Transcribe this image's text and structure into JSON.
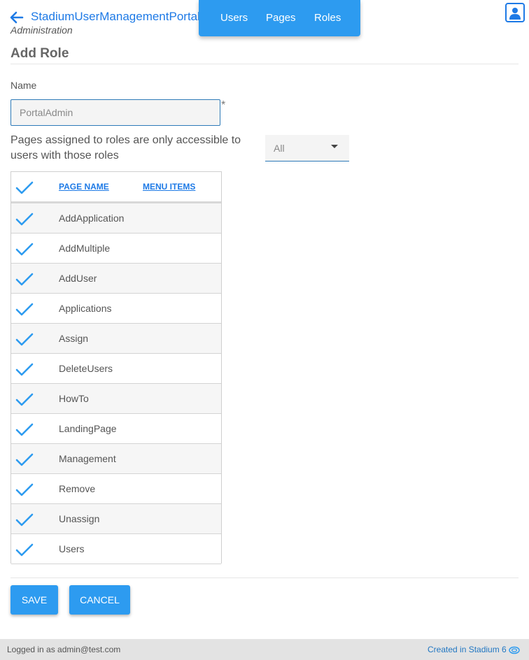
{
  "header": {
    "app_title": "StadiumUserManagementPortal",
    "app_subtitle": "Administration",
    "menu": [
      "Users",
      "Pages",
      "Roles"
    ],
    "icons": {
      "back": "arrow-left-icon",
      "user": "user-icon"
    }
  },
  "page": {
    "title": "Add Role"
  },
  "form": {
    "name_label": "Name",
    "name_value": "PortalAdmin",
    "required_mark": "*",
    "info_text": "Pages assigned to roles are only accessible to users with those roles",
    "filter": {
      "selected": "All"
    }
  },
  "grid": {
    "headers": {
      "page_name": "PAGE NAME",
      "menu_items": "MENU ITEMS"
    },
    "all_checked": true,
    "rows": [
      {
        "name": "AddApplication",
        "checked": true
      },
      {
        "name": "AddMultiple",
        "checked": true
      },
      {
        "name": "AddUser",
        "checked": true
      },
      {
        "name": "Applications",
        "checked": true
      },
      {
        "name": "Assign",
        "checked": true
      },
      {
        "name": "DeleteUsers",
        "checked": true
      },
      {
        "name": "HowTo",
        "checked": true
      },
      {
        "name": "LandingPage",
        "checked": true
      },
      {
        "name": "Management",
        "checked": true
      },
      {
        "name": "Remove",
        "checked": true
      },
      {
        "name": "Unassign",
        "checked": true
      },
      {
        "name": "Users",
        "checked": true
      }
    ]
  },
  "buttons": {
    "save": "SAVE",
    "cancel": "CANCEL"
  },
  "footer": {
    "logged_in": "Logged in as admin@test.com",
    "created": "Created in Stadium 6"
  },
  "colors": {
    "accent": "#2d9bf0",
    "link": "#1e7ae6",
    "check": "#2d9bf0",
    "footer_bg": "#e3e3e3"
  }
}
